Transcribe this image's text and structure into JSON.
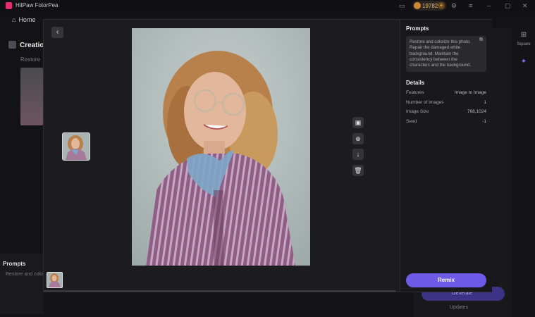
{
  "app": {
    "title": "HitPaw FotorPea",
    "credits": "19782"
  },
  "nav": {
    "home_label": "Home"
  },
  "background": {
    "section_title": "Creation",
    "restore_label": "Restore",
    "prompts_label": "Prompts",
    "prompt_preview": "Restore and colo",
    "generate_label": "Generate",
    "updates_label": "Updates",
    "rail_square_label": "Square"
  },
  "preview": {
    "colors": {
      "backdrop": "#b9c2c0",
      "shirt_stripe_a": "#8e5e86",
      "shirt_stripe_b": "#c7a7bf",
      "scarf": "#7fa6c7",
      "hair": "#b8804a",
      "skin": "#e3b79c"
    }
  },
  "panel": {
    "prompts_title": "Prompts",
    "prompt_text": "Restore and colorize this photo. Repair the damaged white background. Maintain the consistency between the characters and the background.",
    "details_title": "Details",
    "details": [
      {
        "label": "Features",
        "value": "Image to Image"
      },
      {
        "label": "Number of Images",
        "value": "1"
      },
      {
        "label": "Image Size",
        "value": "768,1024"
      },
      {
        "label": "Seed",
        "value": "-1"
      }
    ],
    "remix_label": "Remix"
  },
  "icons": {
    "back": "‹",
    "tools": [
      "image-compare-icon",
      "zoom-in-icon",
      "download-icon",
      "delete-icon"
    ]
  }
}
